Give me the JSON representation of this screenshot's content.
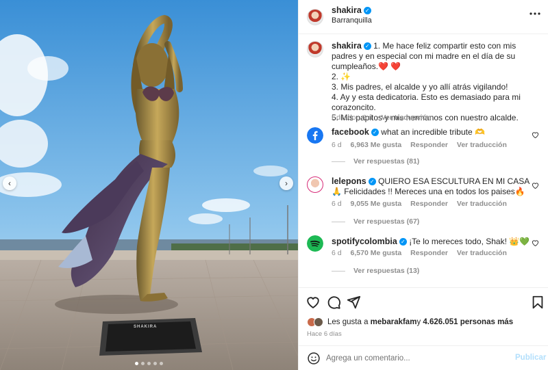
{
  "post": {
    "username": "shakira",
    "location": "Barranquilla",
    "caption_lines": [
      "1. Me hace feliz compartir esto con mis padres y en especial con mi madre en el día de su cumpleaños.❤️ ❤️",
      "2. ✨",
      "3. Mis padres, el alcalde y yo allí atrás vigilando!",
      "4. Ay y esta dedicatoria. Esto es demasiado para mi corazoncito.",
      "5. Mis papitos y mis hermanos con nuestro alcalde."
    ],
    "caption_meta": {
      "edited": "Editado · 6 d",
      "translate": "Ver traducción"
    },
    "image": {
      "plaque_text": "SHAKIRA"
    }
  },
  "comments": [
    {
      "user": "facebook",
      "text": "what an incredible tribute 🫶",
      "age": "6 d",
      "likes": "6,963 Me gusta",
      "reply": "Responder",
      "translate": "Ver traducción",
      "replies": "Ver respuestas (81)",
      "avatar_color": "#1877f2"
    },
    {
      "user": "lelepons",
      "text": "QUIERO ESA ESCULTURA EN MI CASA🙏 Felicidades !! Mereces una en todos los paises🔥",
      "age": "6 d",
      "likes": "9,055 Me gusta",
      "reply": "Responder",
      "translate": "Ver traducción",
      "replies": "Ver respuestas (67)",
      "avatar_color": "#f0c7b0"
    },
    {
      "user": "spotifycolombia",
      "text": "¡Te lo mereces todo, Shak! 👑💚",
      "age": "6 d",
      "likes": "6,570 Me gusta",
      "reply": "Responder",
      "translate": "Ver traducción",
      "replies": "Ver respuestas (13)",
      "avatar_color": "#1db954"
    }
  ],
  "likes_summary": {
    "prefix": "Les gusta a ",
    "user": "mebarakfam",
    "middle": " y ",
    "count": "4.626.051 personas más"
  },
  "posted_ago": "Hace 6 días",
  "composer": {
    "placeholder": "Agrega un comentario...",
    "publish": "Publicar"
  },
  "colors": {
    "verified": "#0095f6",
    "meta": "#8e8e8e",
    "publish_disabled": "#b2dffc",
    "heart": "#ed4956"
  }
}
